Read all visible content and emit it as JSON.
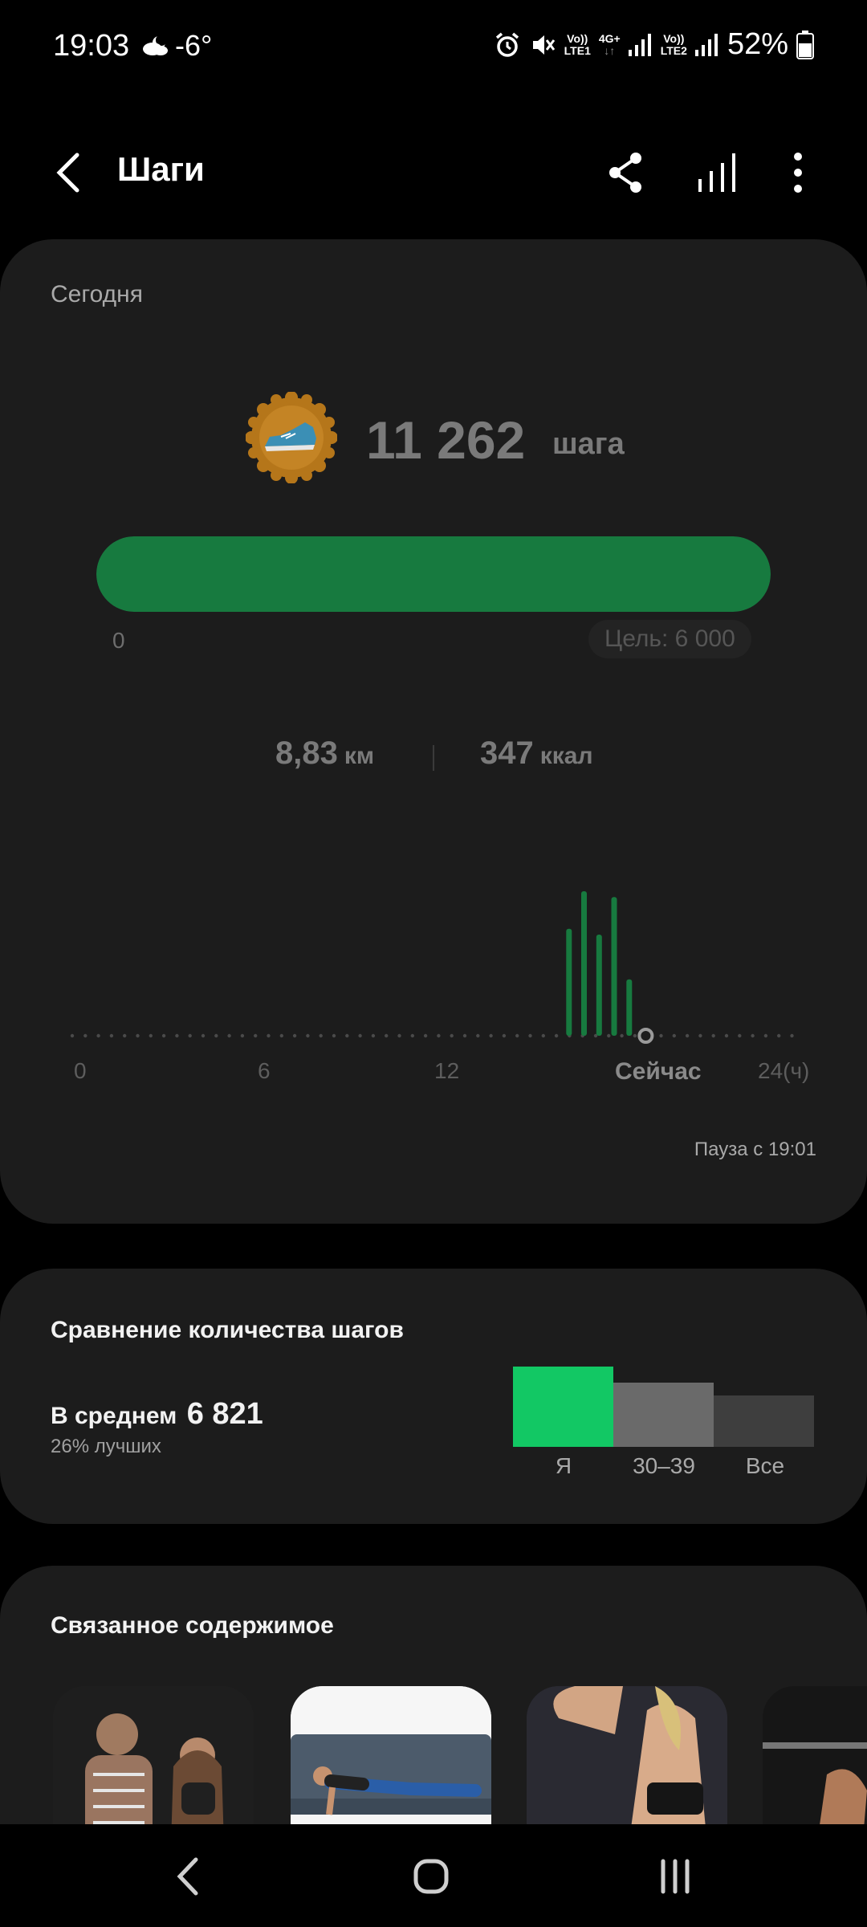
{
  "status_bar": {
    "time": "19:03",
    "weather": "-6°",
    "sim1": {
      "top": "Vo))",
      "bottom": "LTE1"
    },
    "sim1_net": "4G+",
    "sim2": {
      "top": "Vo))",
      "bottom": "LTE2"
    },
    "battery": "52%"
  },
  "app_bar": {
    "title": "Шаги",
    "icons": [
      "back-icon",
      "share-icon",
      "stats-icon",
      "more-icon"
    ]
  },
  "today": {
    "label": "Сегодня",
    "steps": "11 262",
    "steps_unit": "шага",
    "progress_fraction": 1.0,
    "progress_min": "0",
    "goal": "Цель: 6 000",
    "distance": "8,83",
    "distance_unit": "км",
    "calories": "347",
    "calories_unit": "ккал",
    "now_label": "Сейчас",
    "pause_text": "Пауза с 19:01"
  },
  "chart_data": {
    "type": "bar",
    "x_ticks": [
      "0",
      "6",
      "12",
      "24(ч)"
    ],
    "xlim": [
      0,
      24
    ],
    "bars": [
      {
        "hour": 16.5,
        "value": 0.74
      },
      {
        "hour": 17.0,
        "value": 1.0
      },
      {
        "hour": 17.5,
        "value": 0.7
      },
      {
        "hour": 18.0,
        "value": 0.96
      },
      {
        "hour": 18.5,
        "value": 0.39
      }
    ],
    "now_hour": 19.05,
    "bar_color": "#177a3f"
  },
  "comparison": {
    "title": "Сравнение количества шагов",
    "avg_label": "В среднем",
    "avg_value": "6 821",
    "rank": "26% лучших",
    "bars": [
      {
        "label": "Я",
        "value": 11262,
        "color": "#12c864"
      },
      {
        "label": "30–39",
        "value": 9000,
        "color": "#6a6a6a"
      },
      {
        "label": "Все",
        "value": 7200,
        "color": "#3e3e3e"
      }
    ]
  },
  "related": {
    "title": "Связанное содержимое",
    "items": [
      "anatomy-fitness-image",
      "plank-exercise-image",
      "back-workout-image",
      "gym-image"
    ]
  },
  "nav_bar": {
    "icons": [
      "nav-back-icon",
      "home-icon",
      "recents-icon"
    ]
  },
  "colors": {
    "accent": "#177a3f",
    "card": "#1c1c1c",
    "background": "#000000"
  }
}
